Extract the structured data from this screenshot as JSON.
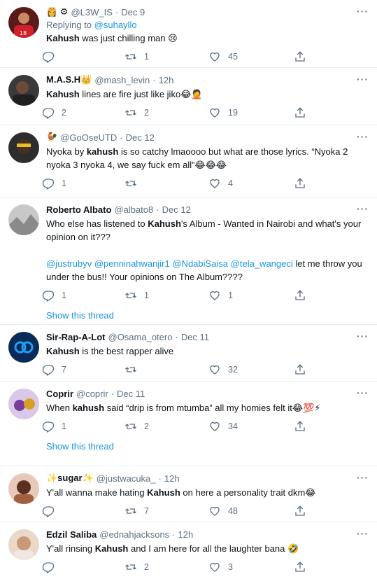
{
  "tweets": [
    {
      "name": "",
      "name_prefix": "👸 ⚙",
      "handle": "@L3W_IS",
      "time": "Dec 9",
      "replying_label": "Replying to",
      "replying_to": "@suhayllo",
      "text_bold": "Kahush",
      "text_rest": " was just chilling man 😢",
      "replies": "",
      "retweets": "1",
      "likes": "45"
    },
    {
      "name": "M.A.S.H👑",
      "handle": "@mash_levin",
      "time": "12h",
      "text_bold": "Kahush",
      "text_rest": " lines are fire just like jiko😂🤦",
      "replies": "2",
      "retweets": "2",
      "likes": "19"
    },
    {
      "name": "🐓",
      "handle": "@GoOseUTD",
      "time": "Dec 12",
      "text_pre": "Nyoka by ",
      "text_bold": "kahush",
      "text_rest": " is so catchy lmaoooo but what are those lyrics. “Nyoka 2 nyoka 3 nyoka 4, we say fuck em all”😂😂😂",
      "replies": "1",
      "retweets": "",
      "likes": "4"
    },
    {
      "name": "Roberto Albato",
      "handle": "@albato8",
      "time": "Dec 12",
      "text_pre": "Who else has listened to ",
      "text_bold": "Kahush",
      "text_rest": "'s Album - Wanted in Nairobi and what's your opinion on it???",
      "mentions": [
        "@justrubyv",
        "@penninahwanjir1",
        "@NdabiSaisa",
        "@tela_wangeci"
      ],
      "text_after": " let me throw you under the bus!! Your opinions on The Album????",
      "replies": "1",
      "retweets": "1",
      "likes": "1",
      "show_thread": "Show this thread"
    },
    {
      "name": "Sir-Rap-A-Lot",
      "handle": "@Osama_otero",
      "time": "Dec 11",
      "text_bold": "Kahush",
      "text_rest": " is the best rapper alive",
      "replies": "7",
      "retweets": "",
      "likes": "32"
    },
    {
      "name": "Coprir",
      "handle": "@coprir",
      "time": "Dec 11",
      "text_pre": "When ",
      "text_bold": "kahush",
      "text_rest": " said “drip is from mtumba” all my homies felt it😂💯⚡",
      "replies": "1",
      "retweets": "2",
      "likes": "34",
      "show_thread": "Show this thread"
    },
    {
      "name": "✨sugar✨",
      "handle": "@justwacuka_",
      "time": "12h",
      "text_pre": "Y'all wanna make hating ",
      "text_bold": "Kahush",
      "text_rest": " on here a personality trait dkm😂",
      "replies": "",
      "retweets": "7",
      "likes": "48"
    },
    {
      "name": "Edzil Saliba",
      "handle": "@ednahjacksons",
      "time": "12h",
      "text_pre": "Y'all rinsing ",
      "text_bold": "Kahush",
      "text_rest": " and I am here for all the laughter bana 🤣",
      "replies": "",
      "retweets": "2",
      "likes": "3"
    }
  ],
  "more_icon": "more-horizontal-icon",
  "icons": {
    "reply": "reply-icon",
    "retweet": "retweet-icon",
    "like": "heart-icon",
    "share": "share-icon"
  },
  "colors": {
    "link": "#1b95e0",
    "secondary": "#5b7083",
    "border": "#e6ecf0"
  }
}
